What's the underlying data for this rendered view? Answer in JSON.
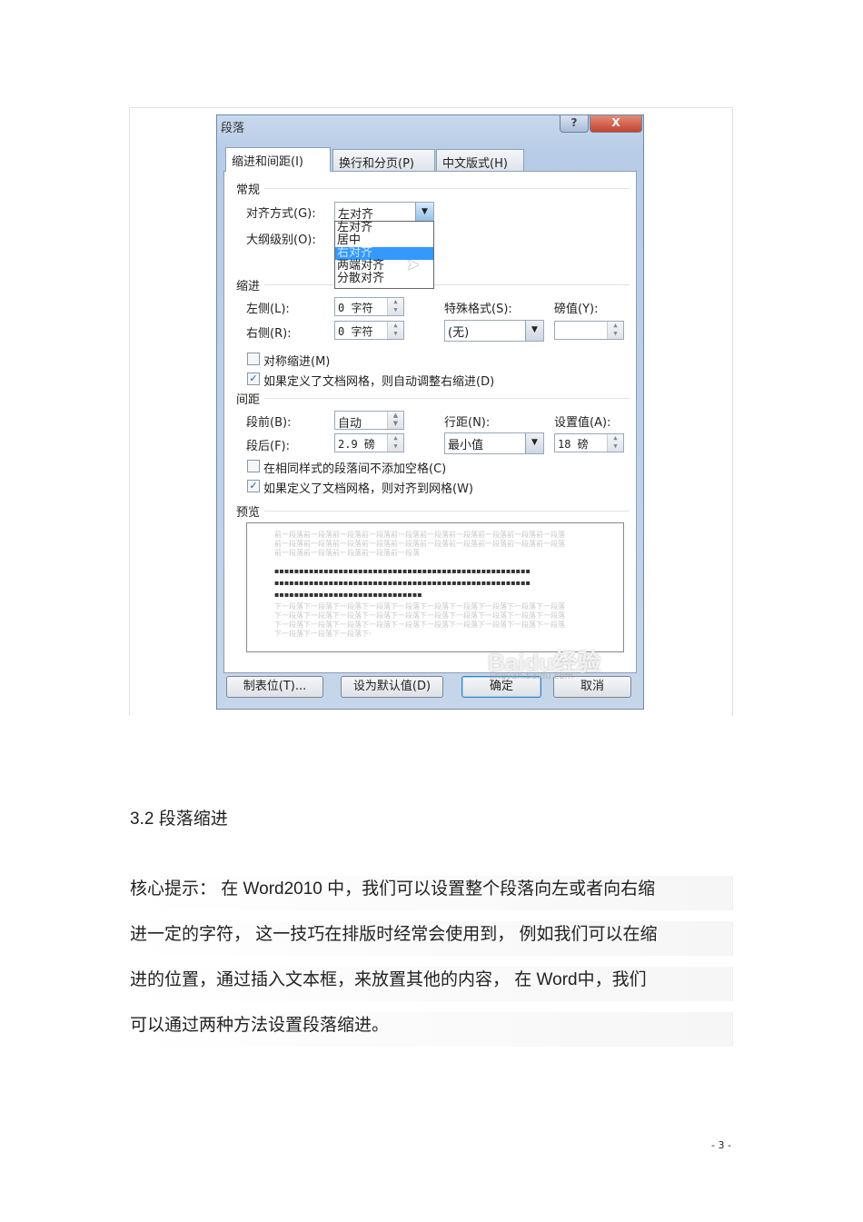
{
  "dialog": {
    "title": "段落",
    "help_label": "?",
    "close_label": "X",
    "tabs": [
      "缩进和间距(I)",
      "换行和分页(P)",
      "中文版式(H)"
    ],
    "general": {
      "heading": "常规",
      "alignment_label": "对齐方式(G):",
      "alignment_value": "左对齐",
      "outline_label": "大纲级别(O):",
      "alignment_options": [
        "左对齐",
        "居中",
        "右对齐",
        "两端对齐",
        "分散对齐"
      ]
    },
    "indent": {
      "heading": "缩进",
      "left_label": "左侧(L):",
      "left_value": "0 字符",
      "right_label": "右侧(R):",
      "right_value": "0 字符",
      "special_label": "特殊格式(S):",
      "special_value": "(无)",
      "by_label": "磅值(Y):",
      "by_value": "",
      "mirror_label": "对称缩进(M)",
      "mirror_checked": false,
      "auto_label": "如果定义了文档网格，则自动调整右缩进(D)",
      "auto_checked": true
    },
    "spacing": {
      "heading": "间距",
      "before_label": "段前(B):",
      "before_value": "自动",
      "after_label": "段后(F):",
      "after_value": "2.9 磅",
      "line_label": "行距(N):",
      "line_value": "最小值",
      "at_label": "设置值(A):",
      "at_value": "18 磅",
      "nospace_label": "在相同样式的段落间不添加空格(C)",
      "nospace_checked": false,
      "grid_label": "如果定义了文档网格，则对齐到网格(W)",
      "grid_checked": true
    },
    "preview": {
      "heading": "预览",
      "prev_text": "前一段落前一段落前一段落前一段落前一段落前一段落前一段落前一段落前一段落前一段落",
      "next_text": "下一段落下一段落下一段落下一段落下一段落下一段落下一段落下一段落下一段落下一段落"
    },
    "buttons": {
      "tabs": "制表位(T)...",
      "default": "设为默认值(D)",
      "ok": "确定",
      "cancel": "取消"
    },
    "watermark": "Baidu经验",
    "watermark_url": "jingyan.baidu.com"
  },
  "doc": {
    "heading": "3.2  段落缩进",
    "lines": [
      "核心提示：  在 Word2010 中，我们可以设置整个段落向左或者向右缩",
      "进一定的字符，  这一技巧在排版时经常会使用到，    例如我们可以在缩",
      "进的位置，通过插入文本框，来放置其他的内容，  在        Word中，我们",
      "可以通过两种方法设置段落缩进。"
    ],
    "page_number": "- 3 -"
  }
}
